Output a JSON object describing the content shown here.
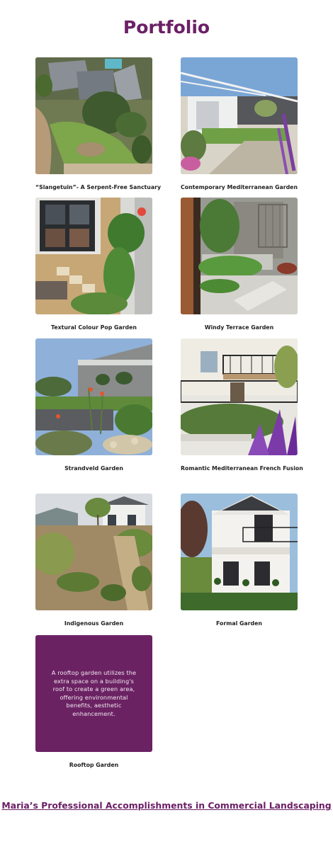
{
  "page": {
    "title": "Portfolio"
  },
  "gallery": [
    {
      "caption": "“Slangetuin”- A Serpent-Free Sanctuary",
      "image": "aerial-garden-photo"
    },
    {
      "caption": "Contemporary Mediterranean Garden",
      "image": "pergola-garden-photo"
    },
    {
      "caption": "Textural Colour Pop Garden",
      "image": "gravel-pathway-photo"
    },
    {
      "caption": "Windy Terrace Garden",
      "image": "terrace-garden-photo"
    },
    {
      "caption": "Strandveld Garden",
      "image": "coastal-garden-photo"
    },
    {
      "caption": "Romantic Mediterranean French Fusion",
      "image": "french-villa-garden-photo"
    },
    {
      "caption": "Indigenous Garden",
      "image": "indigenous-garden-photo"
    },
    {
      "caption": "Formal Garden",
      "image": "formal-garden-photo"
    },
    {
      "caption": "Rooftop Garden",
      "description": "A rooftop garden utilizes the extra space on a building's roof to create a green area, offering environmental benefits, aesthetic enhancement."
    }
  ],
  "footer": {
    "link_text": "Maria’s Professional Accomplishments in Commercial Landscaping"
  },
  "colors": {
    "brand": "#6b2066",
    "rooftop_tile": "#6b2263"
  }
}
